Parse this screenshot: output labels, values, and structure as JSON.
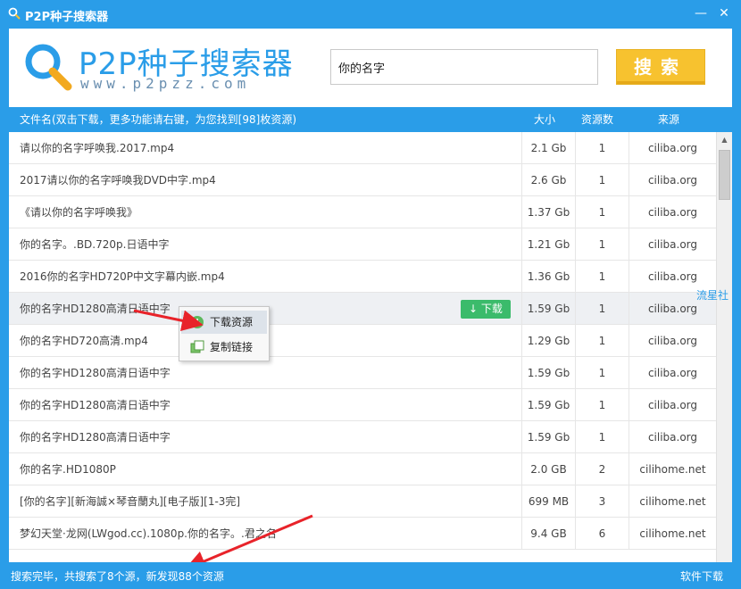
{
  "window": {
    "title": "P2P种子搜索器",
    "minimize": "—",
    "close": "✕"
  },
  "logo": {
    "title": "P2P种子搜索器",
    "url": "www.p2pzz.com"
  },
  "search": {
    "value": "你的名字",
    "button_label": "搜索"
  },
  "table": {
    "headers": {
      "name": "文件名(双击下载，更多功能请右键，为您找到[98]枚资源)",
      "size": "大小",
      "count": "资源数",
      "source": "来源"
    },
    "rows": [
      {
        "name": "请以你的名字呼唤我.2017.mp4",
        "size": "2.1 Gb",
        "count": "1",
        "source": "ciliba.org"
      },
      {
        "name": "2017请以你的名字呼唤我DVD中字.mp4",
        "size": "2.6 Gb",
        "count": "1",
        "source": "ciliba.org"
      },
      {
        "name": "《请以你的名字呼唤我》",
        "size": "1.37 Gb",
        "count": "1",
        "source": "ciliba.org"
      },
      {
        "name": "你的名字。.BD.720p.日语中字",
        "size": "1.21 Gb",
        "count": "1",
        "source": "ciliba.org"
      },
      {
        "name": "2016你的名字HD720P中文字幕内嵌.mp4",
        "size": "1.36 Gb",
        "count": "1",
        "source": "ciliba.org"
      },
      {
        "name": "你的名字HD1280高清日语中字",
        "size": "1.59 Gb",
        "count": "1",
        "source": "ciliba.org"
      },
      {
        "name": "你的名字HD720高清.mp4",
        "size": "1.29 Gb",
        "count": "1",
        "source": "ciliba.org"
      },
      {
        "name": "你的名字HD1280高清日语中字",
        "size": "1.59 Gb",
        "count": "1",
        "source": "ciliba.org"
      },
      {
        "name": "你的名字HD1280高清日语中字",
        "size": "1.59 Gb",
        "count": "1",
        "source": "ciliba.org"
      },
      {
        "name": "你的名字HD1280高清日语中字",
        "size": "1.59 Gb",
        "count": "1",
        "source": "ciliba.org"
      },
      {
        "name": "你的名字.HD1080P",
        "size": "2.0 GB",
        "count": "2",
        "source": "cilihome.net"
      },
      {
        "name": "[你的名字][新海誠×琴音蘭丸][电子版][1-3完]",
        "size": "699 MB",
        "count": "3",
        "source": "cilihome.net"
      },
      {
        "name": "梦幻天堂·龙网(LWgod.cc).1080p.你的名字。.君之名",
        "size": "9.4 GB",
        "count": "6",
        "source": "cilihome.net"
      }
    ],
    "row_download_label": "下载"
  },
  "context_menu": {
    "download": "下载资源",
    "copy_link": "复制链接"
  },
  "side_text": "流星社",
  "status": {
    "left": "搜索完毕，共搜索了8个源，新发现88个资源",
    "right": "软件下载"
  },
  "colors": {
    "primary": "#2a9de8",
    "search_button": "#f7c22f",
    "download_button": "#3bbb6b",
    "arrow": "#e8232a"
  }
}
